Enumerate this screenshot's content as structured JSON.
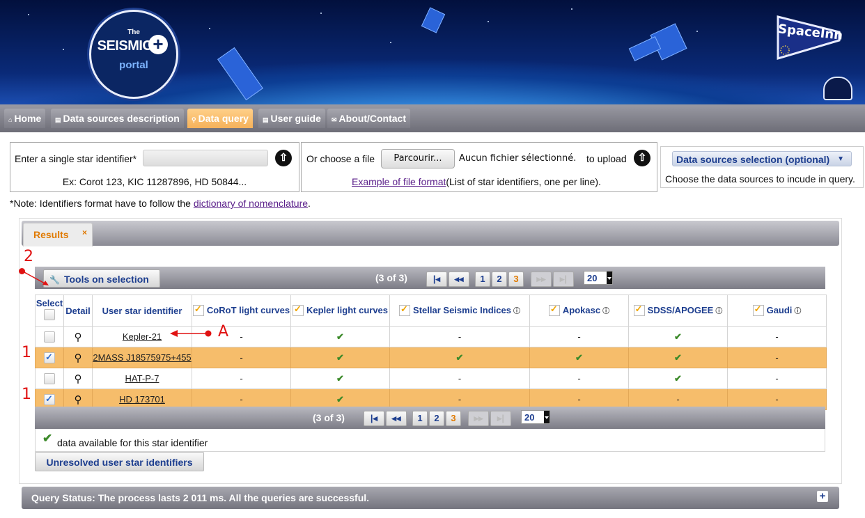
{
  "branding": {
    "logo_line1": "SEISMIC",
    "logo_line2": "portal",
    "logo_small": "The",
    "partner_logo": "SpaceInn"
  },
  "nav": {
    "tabs": [
      {
        "label": "Home",
        "icon": "home-icon"
      },
      {
        "label": "Data sources description",
        "icon": "document-icon"
      },
      {
        "label": "Data query",
        "icon": "search-icon",
        "active": true
      },
      {
        "label": "User guide",
        "icon": "document-icon"
      },
      {
        "label": "About/Contact",
        "icon": "mail-icon"
      }
    ]
  },
  "query": {
    "single_label": "Enter a single star identifier*",
    "single_value": "",
    "single_example": "Ex: Corot 123, KIC 11287896, HD 50844...",
    "file_label": "Or choose a file",
    "browse_button": "Parcourir...",
    "no_file": "Aucun fichier sélectionné.",
    "to_upload": "to upload",
    "example_link": "Example of file format",
    "example_suffix": "(List of star identifiers, one per line).",
    "sources_button": "Data sources selection (optional)",
    "sources_hint": "Choose the data sources to incude in query.",
    "note_prefix": "*Note: Identifiers format have to follow the ",
    "note_link": "dictionary of nomenclature",
    "note_suffix": "."
  },
  "results": {
    "tab_label": "Results",
    "tools_button": "Tools on selection",
    "page_info": "(3 of 3)",
    "pages": [
      "1",
      "2",
      "3"
    ],
    "current_page": "3",
    "rows_per_page": "20",
    "columns": {
      "select": "Select",
      "detail": "Detail",
      "identifier": "User star identifier",
      "corot": "CoRoT light curves",
      "kepler": "Kepler light curves",
      "seismic": "Stellar Seismic Indices",
      "apokasc": "Apokasc",
      "apogee": "SDSS/APOGEE",
      "gaudi": "Gaudi"
    },
    "rows": [
      {
        "id": "Kepler-21",
        "selected": false,
        "corot": "-",
        "kepler": "✔",
        "seismic": "-",
        "apokasc": "-",
        "apogee": "✔",
        "gaudi": "-"
      },
      {
        "id": "2MASS J18575975+455",
        "selected": true,
        "corot": "-",
        "kepler": "✔",
        "seismic": "✔",
        "apokasc": "✔",
        "apogee": "✔",
        "gaudi": "-"
      },
      {
        "id": "HAT-P-7",
        "selected": false,
        "corot": "-",
        "kepler": "✔",
        "seismic": "-",
        "apokasc": "-",
        "apogee": "✔",
        "gaudi": "-"
      },
      {
        "id": "HD 173701",
        "selected": true,
        "corot": "-",
        "kepler": "✔",
        "seismic": "-",
        "apokasc": "-",
        "apogee": "-",
        "gaudi": "-"
      }
    ],
    "legend": "data available for this star identifier",
    "unresolved_button": "Unresolved user star identifiers"
  },
  "annotations": {
    "label_1": "1",
    "label_2": "2",
    "label_A": "A"
  },
  "status": {
    "text": "Query Status: The process lasts 2 011 ms. All the queries are successful.",
    "expand": "+"
  },
  "colors": {
    "accent_orange": "#f5b15a",
    "link_blue": "#1d3e8f",
    "annotation_red": "#e01212"
  }
}
